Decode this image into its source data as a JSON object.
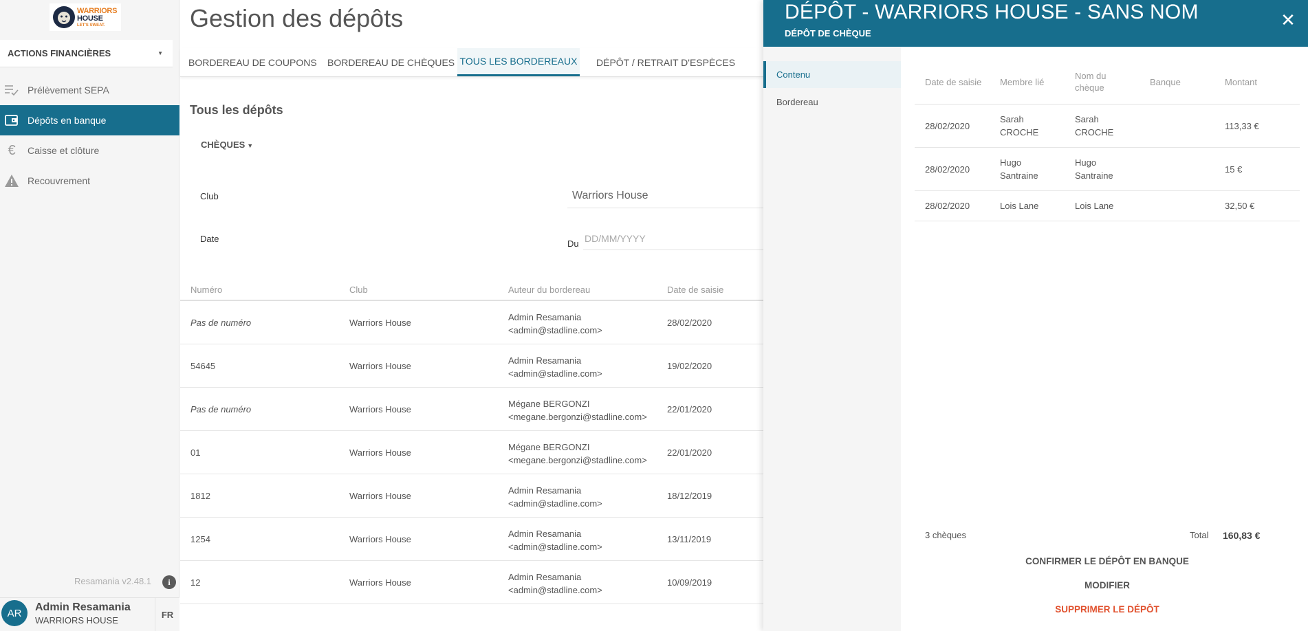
{
  "sidebar": {
    "logo": {
      "line1": "WARRIORS",
      "line2": "HOUSE",
      "tagline": "LET'S SWEAT."
    },
    "section_select": "ACTIONS FINANCIÈRES",
    "items": [
      {
        "label": "Prélèvement SEPA",
        "icon": "list-check-icon"
      },
      {
        "label": "Dépôts en banque",
        "icon": "wallet-icon"
      },
      {
        "label": "Caisse et clôture",
        "icon": "euro-icon"
      },
      {
        "label": "Recouvrement",
        "icon": "warning-icon"
      }
    ],
    "version": "Resamania v2.48.1",
    "user": {
      "initials": "AR",
      "name": "Admin Resamania",
      "club": "WARRIORS HOUSE"
    },
    "language": "FR"
  },
  "main": {
    "title": "Gestion des dépôts",
    "tabs": [
      {
        "label": "BORDEREAU DE COUPONS"
      },
      {
        "label": "BORDEREAU DE CHÈQUES"
      },
      {
        "label": "TOUS LES BORDEREAUX"
      },
      {
        "label": "DÉPÔT / RETRAIT D'ESPÈCES"
      }
    ],
    "section_title": "Tous les dépôts",
    "filter_type": "CHÈQUES",
    "filters": {
      "club_label": "Club",
      "club_value": "Warriors House",
      "date_label": "Date",
      "from_label": "Du",
      "date_placeholder": "DD/MM/YYYY"
    },
    "table": {
      "headers": [
        "Numéro",
        "Club",
        "Auteur du bordereau",
        "Date de saisie"
      ],
      "rows": [
        {
          "number": "Pas de numéro",
          "club": "Warriors House",
          "author_name": "Admin Resamania",
          "author_email": "<admin@stadline.com>",
          "date": "28/02/2020"
        },
        {
          "number": "54645",
          "club": "Warriors House",
          "author_name": "Admin Resamania",
          "author_email": "<admin@stadline.com>",
          "date": "19/02/2020"
        },
        {
          "number": "Pas de numéro",
          "club": "Warriors House",
          "author_name": "Mégane BERGONZI",
          "author_email": "<megane.bergonzi@stadline.com>",
          "date": "22/01/2020"
        },
        {
          "number": "01",
          "club": "Warriors House",
          "author_name": "Mégane BERGONZI",
          "author_email": "<megane.bergonzi@stadline.com>",
          "date": "22/01/2020"
        },
        {
          "number": "1812",
          "club": "Warriors House",
          "author_name": "Admin Resamania",
          "author_email": "<admin@stadline.com>",
          "date": "18/12/2019"
        },
        {
          "number": "1254",
          "club": "Warriors House",
          "author_name": "Admin Resamania",
          "author_email": "<admin@stadline.com>",
          "date": "13/11/2019"
        },
        {
          "number": "12",
          "club": "Warriors House",
          "author_name": "Admin Resamania",
          "author_email": "<admin@stadline.com>",
          "date": "10/09/2019"
        }
      ]
    }
  },
  "panel": {
    "title": "DÉPÔT - WARRIORS HOUSE - SANS NOM",
    "subtitle": "DÉPÔT DE CHÈQUE",
    "close_glyph": "✕",
    "side_items": [
      {
        "label": "Contenu"
      },
      {
        "label": "Bordereau"
      }
    ],
    "table": {
      "headers": [
        "Date de saisie",
        "Membre lié",
        "Nom du chèque",
        "Banque",
        "Montant"
      ],
      "rows": [
        {
          "date": "28/02/2020",
          "member": "Sarah CROCHE",
          "cheque_name": "Sarah CROCHE",
          "bank": "",
          "amount": "113,33 €"
        },
        {
          "date": "28/02/2020",
          "member": "Hugo Santraine",
          "cheque_name": "Hugo Santraine",
          "bank": "",
          "amount": "15 €"
        },
        {
          "date": "28/02/2020",
          "member": "Lois Lane",
          "cheque_name": "Lois Lane",
          "bank": "",
          "amount": "32,50 €"
        }
      ]
    },
    "count_label": "3 chèques",
    "total_label": "Total",
    "total_value": "160,83 €",
    "actions": {
      "confirm": "CONFIRMER LE DÉPÔT EN BANQUE",
      "modify": "MODIFIER",
      "delete": "SUPPRIMER LE DÉPÔT"
    }
  },
  "colors": {
    "accent": "#176e8d",
    "danger": "#e1522f",
    "brand_orange": "#e67e22"
  }
}
